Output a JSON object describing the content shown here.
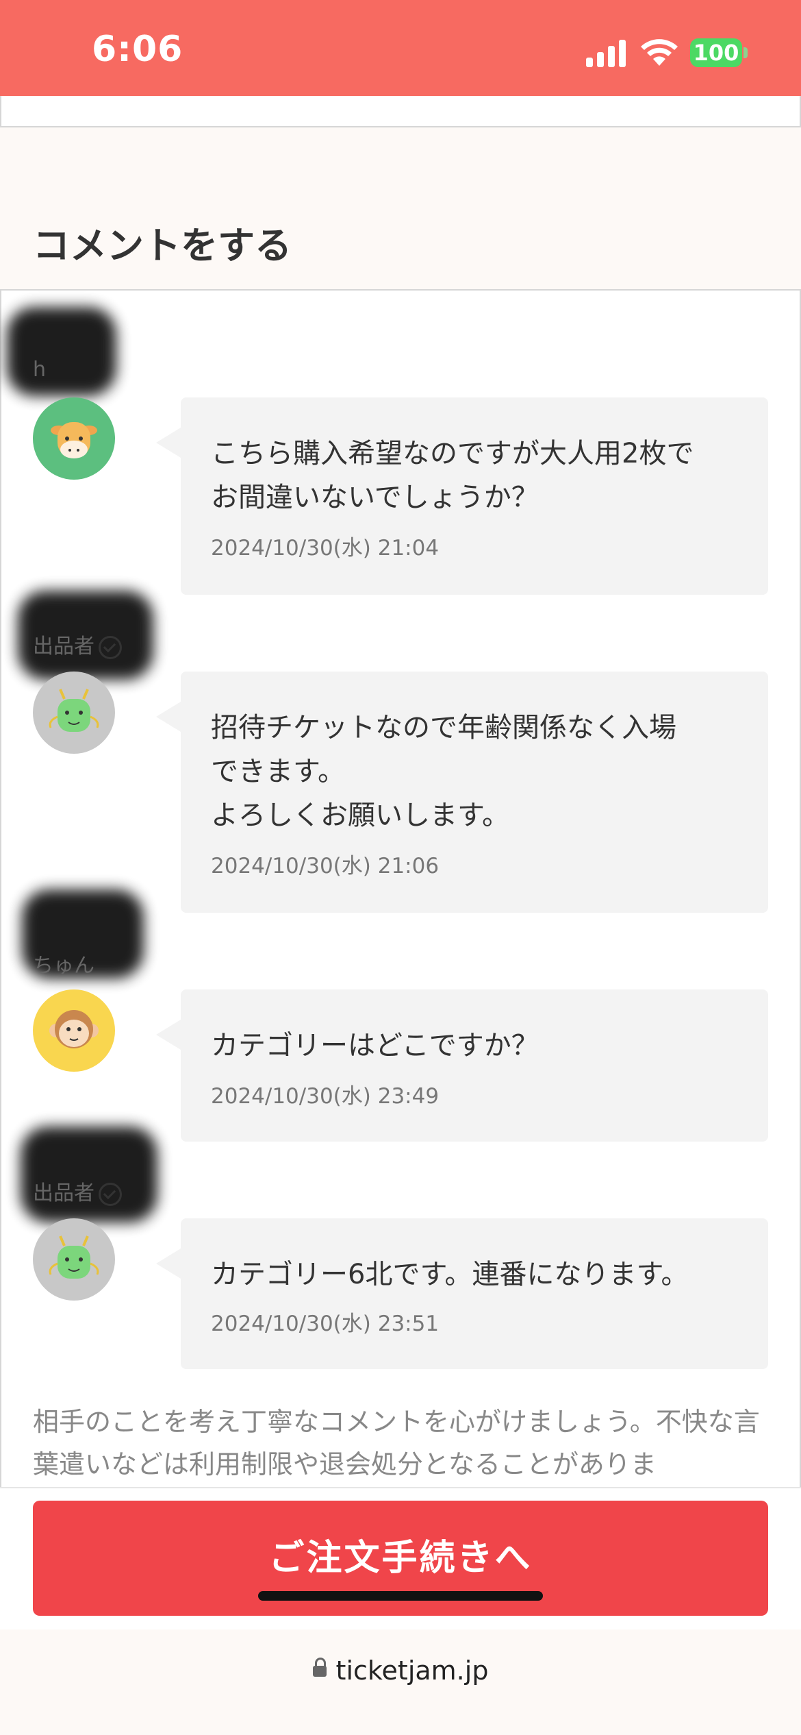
{
  "status_bar": {
    "time": "6:06",
    "battery": "100",
    "icons": [
      "cellular-signal-icon",
      "wifi-icon",
      "battery-icon"
    ]
  },
  "section": {
    "title": "コメントをする"
  },
  "comments": [
    {
      "name": "h",
      "avatar": "cow-avatar",
      "text": "こちら購入希望なのですが大人用2枚で\nお間違いないでしょうか？",
      "date": "2024/10/30(水) 21:04"
    },
    {
      "name": "出品者",
      "seller_verified": true,
      "avatar": "dragon-avatar",
      "text": "招待チケットなので年齢関係なく入場\nできます。\nよろしくお願いします。",
      "date": "2024/10/30(水) 21:06"
    },
    {
      "name": "ちゅん",
      "avatar": "monkey-avatar",
      "text": "カテゴリーはどこですか？",
      "date": "2024/10/30(水) 23:49"
    },
    {
      "name": "出品者",
      "seller_verified": true,
      "avatar": "dragon-avatar",
      "text": "カテゴリー6北です。連番になります。",
      "date": "2024/10/30(水) 23:51"
    }
  ],
  "notice": "相手のことを考え丁寧なコメントを心がけましょう。不快な言葉遣いなどは利用制限や退会処分となることがありま",
  "order_button": "ご注文手続きへ",
  "browser": {
    "url": "ticketjam.jp"
  },
  "colors": {
    "status_bar": "#f76a61",
    "order_button": "#f0454a",
    "battery": "#4cd964",
    "bubble": "#f3f3f3"
  }
}
